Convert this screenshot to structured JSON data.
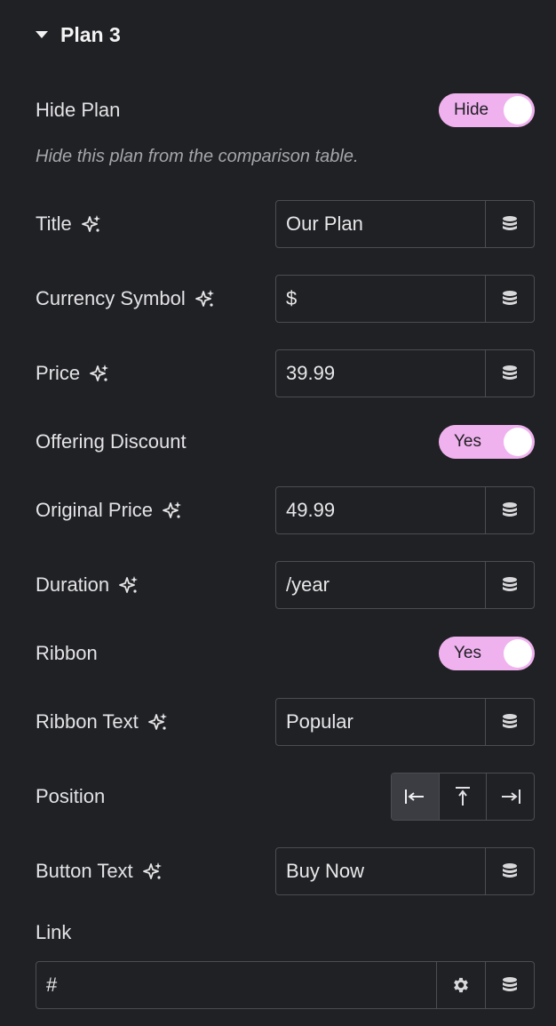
{
  "section": {
    "title": "Plan 3",
    "expanded": true
  },
  "hide_plan": {
    "label": "Hide Plan",
    "toggle_text": "Hide",
    "description": "Hide this plan from the comparison table."
  },
  "fields": {
    "title": {
      "label": "Title",
      "value": "Our Plan"
    },
    "currency_symbol": {
      "label": "Currency Symbol",
      "value": "$"
    },
    "price": {
      "label": "Price",
      "value": "39.99"
    },
    "original_price": {
      "label": "Original Price",
      "value": "49.99"
    },
    "duration": {
      "label": "Duration",
      "value": "/year"
    },
    "ribbon_text": {
      "label": "Ribbon Text",
      "value": "Popular"
    },
    "button_text": {
      "label": "Button Text",
      "value": "Buy Now"
    }
  },
  "offering_discount": {
    "label": "Offering Discount",
    "toggle_text": "Yes"
  },
  "ribbon": {
    "label": "Ribbon",
    "toggle_text": "Yes"
  },
  "position": {
    "label": "Position",
    "options": [
      "left",
      "top",
      "right"
    ],
    "selected": "left"
  },
  "link": {
    "label": "Link",
    "value": "#"
  },
  "colors": {
    "background": "#202124",
    "toggle_on": "#f0b2ef",
    "border": "#4b4d52",
    "active_option": "#3b3d42"
  },
  "icons": {
    "ai": "sparkle-icon",
    "dynamic": "database-icon",
    "settings": "gear-icon",
    "collapse": "caret-down-icon"
  }
}
